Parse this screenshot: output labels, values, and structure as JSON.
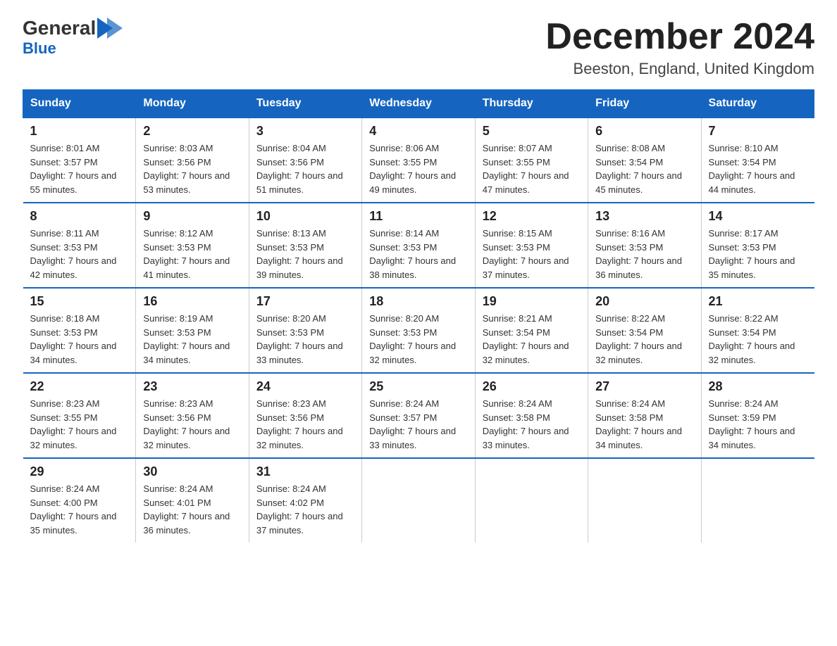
{
  "logo": {
    "general": "General",
    "blue": "Blue",
    "arrow": "▶"
  },
  "title": "December 2024",
  "location": "Beeston, England, United Kingdom",
  "weekdays": [
    "Sunday",
    "Monday",
    "Tuesday",
    "Wednesday",
    "Thursday",
    "Friday",
    "Saturday"
  ],
  "weeks": [
    [
      {
        "day": "1",
        "sunrise": "8:01 AM",
        "sunset": "3:57 PM",
        "daylight": "7 hours and 55 minutes."
      },
      {
        "day": "2",
        "sunrise": "8:03 AM",
        "sunset": "3:56 PM",
        "daylight": "7 hours and 53 minutes."
      },
      {
        "day": "3",
        "sunrise": "8:04 AM",
        "sunset": "3:56 PM",
        "daylight": "7 hours and 51 minutes."
      },
      {
        "day": "4",
        "sunrise": "8:06 AM",
        "sunset": "3:55 PM",
        "daylight": "7 hours and 49 minutes."
      },
      {
        "day": "5",
        "sunrise": "8:07 AM",
        "sunset": "3:55 PM",
        "daylight": "7 hours and 47 minutes."
      },
      {
        "day": "6",
        "sunrise": "8:08 AM",
        "sunset": "3:54 PM",
        "daylight": "7 hours and 45 minutes."
      },
      {
        "day": "7",
        "sunrise": "8:10 AM",
        "sunset": "3:54 PM",
        "daylight": "7 hours and 44 minutes."
      }
    ],
    [
      {
        "day": "8",
        "sunrise": "8:11 AM",
        "sunset": "3:53 PM",
        "daylight": "7 hours and 42 minutes."
      },
      {
        "day": "9",
        "sunrise": "8:12 AM",
        "sunset": "3:53 PM",
        "daylight": "7 hours and 41 minutes."
      },
      {
        "day": "10",
        "sunrise": "8:13 AM",
        "sunset": "3:53 PM",
        "daylight": "7 hours and 39 minutes."
      },
      {
        "day": "11",
        "sunrise": "8:14 AM",
        "sunset": "3:53 PM",
        "daylight": "7 hours and 38 minutes."
      },
      {
        "day": "12",
        "sunrise": "8:15 AM",
        "sunset": "3:53 PM",
        "daylight": "7 hours and 37 minutes."
      },
      {
        "day": "13",
        "sunrise": "8:16 AM",
        "sunset": "3:53 PM",
        "daylight": "7 hours and 36 minutes."
      },
      {
        "day": "14",
        "sunrise": "8:17 AM",
        "sunset": "3:53 PM",
        "daylight": "7 hours and 35 minutes."
      }
    ],
    [
      {
        "day": "15",
        "sunrise": "8:18 AM",
        "sunset": "3:53 PM",
        "daylight": "7 hours and 34 minutes."
      },
      {
        "day": "16",
        "sunrise": "8:19 AM",
        "sunset": "3:53 PM",
        "daylight": "7 hours and 34 minutes."
      },
      {
        "day": "17",
        "sunrise": "8:20 AM",
        "sunset": "3:53 PM",
        "daylight": "7 hours and 33 minutes."
      },
      {
        "day": "18",
        "sunrise": "8:20 AM",
        "sunset": "3:53 PM",
        "daylight": "7 hours and 32 minutes."
      },
      {
        "day": "19",
        "sunrise": "8:21 AM",
        "sunset": "3:54 PM",
        "daylight": "7 hours and 32 minutes."
      },
      {
        "day": "20",
        "sunrise": "8:22 AM",
        "sunset": "3:54 PM",
        "daylight": "7 hours and 32 minutes."
      },
      {
        "day": "21",
        "sunrise": "8:22 AM",
        "sunset": "3:54 PM",
        "daylight": "7 hours and 32 minutes."
      }
    ],
    [
      {
        "day": "22",
        "sunrise": "8:23 AM",
        "sunset": "3:55 PM",
        "daylight": "7 hours and 32 minutes."
      },
      {
        "day": "23",
        "sunrise": "8:23 AM",
        "sunset": "3:56 PM",
        "daylight": "7 hours and 32 minutes."
      },
      {
        "day": "24",
        "sunrise": "8:23 AM",
        "sunset": "3:56 PM",
        "daylight": "7 hours and 32 minutes."
      },
      {
        "day": "25",
        "sunrise": "8:24 AM",
        "sunset": "3:57 PM",
        "daylight": "7 hours and 33 minutes."
      },
      {
        "day": "26",
        "sunrise": "8:24 AM",
        "sunset": "3:58 PM",
        "daylight": "7 hours and 33 minutes."
      },
      {
        "day": "27",
        "sunrise": "8:24 AM",
        "sunset": "3:58 PM",
        "daylight": "7 hours and 34 minutes."
      },
      {
        "day": "28",
        "sunrise": "8:24 AM",
        "sunset": "3:59 PM",
        "daylight": "7 hours and 34 minutes."
      }
    ],
    [
      {
        "day": "29",
        "sunrise": "8:24 AM",
        "sunset": "4:00 PM",
        "daylight": "7 hours and 35 minutes."
      },
      {
        "day": "30",
        "sunrise": "8:24 AM",
        "sunset": "4:01 PM",
        "daylight": "7 hours and 36 minutes."
      },
      {
        "day": "31",
        "sunrise": "8:24 AM",
        "sunset": "4:02 PM",
        "daylight": "7 hours and 37 minutes."
      },
      null,
      null,
      null,
      null
    ]
  ]
}
